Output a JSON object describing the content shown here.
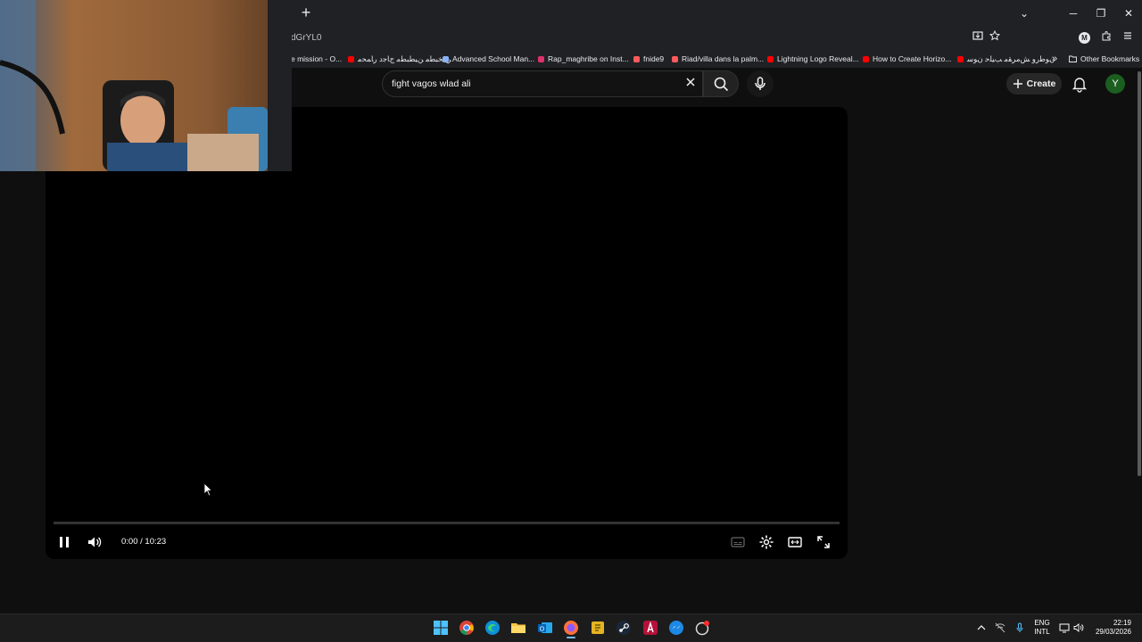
{
  "browser": {
    "url_fragment": "dGrYL0",
    "new_tab_symbol": "+",
    "window_controls": {
      "minimize": "─",
      "restore": "❐",
      "close": "✕",
      "tab_search": "⌄"
    },
    "profile_initial": "M",
    "bookmarks": [
      {
        "label": "e mission - O...",
        "icon": "page-icon",
        "color": "#8ab4f8"
      },
      {
        "label": "ﻦﯿﺨﺒﻄﻣ ﻦﯿﻄﺒﻄﻣ ﺝﺎﺟﺩ ﺭﺎﻤﺤﻣ",
        "icon": "youtube-icon",
        "color": "#ff0000"
      },
      {
        "label": "Advanced School Man...",
        "icon": "shield-icon",
        "color": "#8ab4f8"
      },
      {
        "label": "Rap_maghribe on Inst...",
        "icon": "instagram-icon",
        "color": "#e1306c"
      },
      {
        "label": "fnide9",
        "icon": "airbnb-icon",
        "color": "#ff5a5f"
      },
      {
        "label": "Riad/villa dans la palm...",
        "icon": "airbnb-icon",
        "color": "#ff5a5f"
      },
      {
        "label": "Lightning Logo Reveal...",
        "icon": "youtube-icon",
        "color": "#ff0000"
      },
      {
        "label": "How to Create Horizo...",
        "icon": "youtube-icon",
        "color": "#ff0000"
      },
      {
        "label": "ﻥﻮﻃﺭﻭ ﺶﻣﺮﻘﻣ ﺐﯿﻠﺣ ﻥﻮﺳ",
        "icon": "youtube-icon",
        "color": "#ff0000"
      }
    ],
    "more_bookmarks_symbol": "»",
    "other_bookmarks": "Other Bookmarks"
  },
  "youtube": {
    "search_value": "fight vagos wlad ali",
    "create_label": "Create",
    "user_initial": "Y",
    "accent": "#ff0000"
  },
  "player": {
    "current_time": "0:00",
    "duration": "10:23",
    "time_display": "0:00 / 10:23",
    "progress": 0.0,
    "state": "playing"
  },
  "taskbar": {
    "language_line1": "ENG",
    "language_line2": "INTL",
    "time": "22:19",
    "date": "29/03/2026",
    "apps": [
      "windows-start-icon",
      "chrome-icon",
      "edge-icon",
      "file-explorer-icon",
      "outlook-icon",
      "firefox-icon",
      "sticky-app-icon",
      "steam-icon",
      "creative-app-icon",
      "messenger-app-icon",
      "recording-app-icon"
    ]
  }
}
